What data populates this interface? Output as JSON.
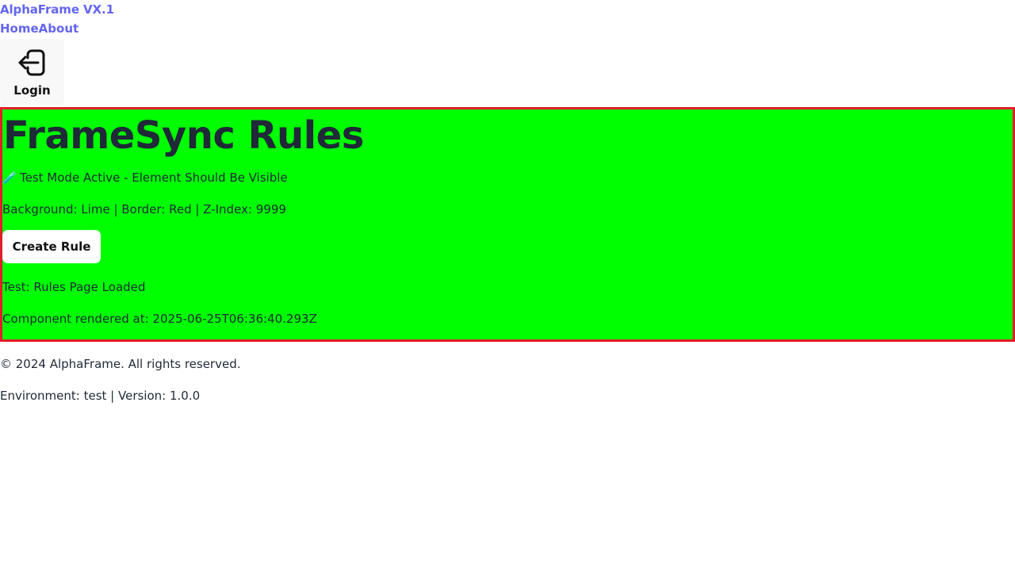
{
  "header": {
    "brand": "AlphaFrame VX.1",
    "nav": [
      {
        "label": "Home"
      },
      {
        "label": "About"
      }
    ],
    "login": {
      "label": "Login",
      "icon": "login-icon"
    }
  },
  "main": {
    "title": "FrameSync Rules",
    "test_mode": {
      "icon": "🧪",
      "text": "Test Mode Active - Element Should Be Visible"
    },
    "style_info": "Background: Lime | Border: Red | Z-Index: 9999",
    "create_button_label": "Create Rule",
    "page_loaded": "Test: Rules Page Loaded",
    "rendered_at": "Component rendered at: 2025-06-25T06:36:40.293Z",
    "colors": {
      "background": "#00ff00",
      "border": "#e11d2a"
    }
  },
  "footer": {
    "copyright": "© 2024 AlphaFrame. All rights reserved.",
    "environment": "Environment: test | Version: 1.0.0"
  },
  "colors": {
    "link": "#6366f1",
    "text": "#1f2937"
  }
}
